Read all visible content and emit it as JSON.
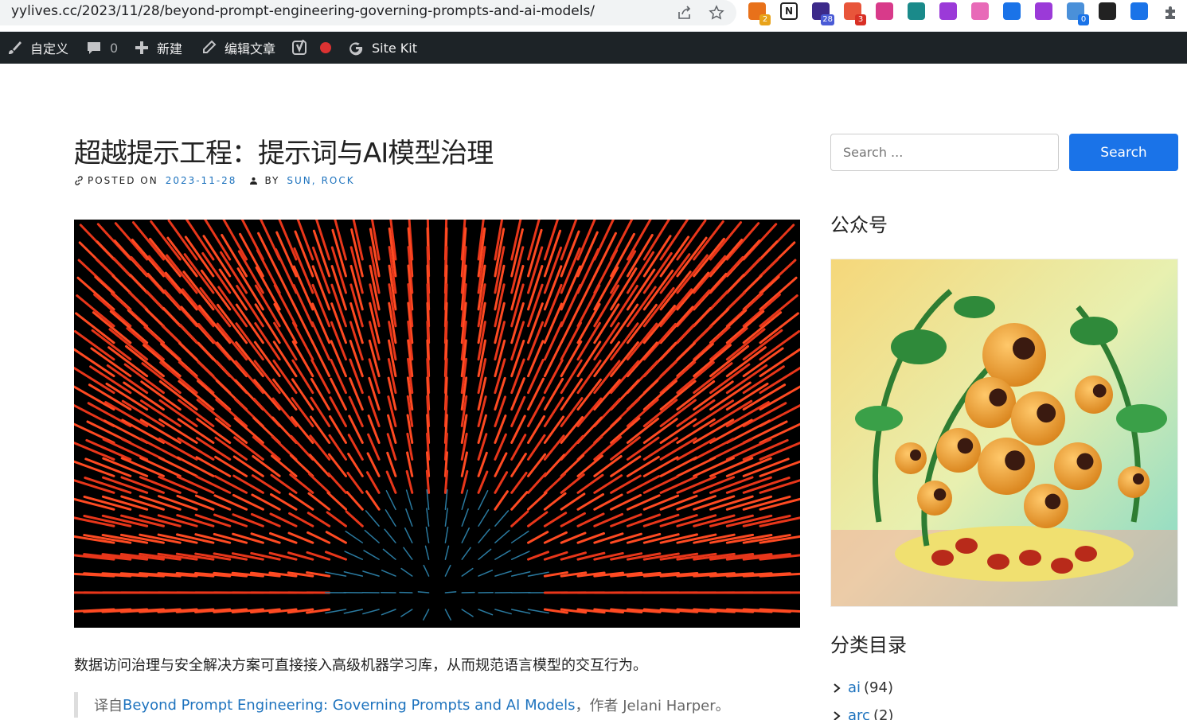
{
  "browser": {
    "url": "yylives.cc/2023/11/28/beyond-prompt-engineering-governing-prompts-and-ai-models/",
    "extensions": [
      {
        "name": "chrome-ext-1",
        "badge": "2",
        "color": "#e8711a",
        "badge_color": "#e8a31a"
      },
      {
        "name": "notion",
        "badge": "",
        "color": "#ffffff"
      },
      {
        "name": "graduation-cap",
        "badge": "28",
        "color": "#3c2a8a",
        "badge_color": "#4a5bd6"
      },
      {
        "name": "chrome-ext-4",
        "badge": "3",
        "color": "#e8553a",
        "badge_color": "#d93025"
      },
      {
        "name": "translate",
        "badge": "",
        "color": "#d83a8a"
      },
      {
        "name": "chrome-ext-6",
        "badge": "",
        "color": "#1a8a8a"
      },
      {
        "name": "chrome-ext-7",
        "badge": "",
        "color": "#9b3ad8"
      },
      {
        "name": "chrome-ext-8",
        "badge": "",
        "color": "#e86ab8"
      },
      {
        "name": "chrome-ext-9",
        "badge": "",
        "color": "#1a73e8"
      },
      {
        "name": "openai",
        "badge": "",
        "color": "#9b3ad8"
      },
      {
        "name": "chrome-ext-11",
        "badge": "0",
        "color": "#4a90d9",
        "badge_color": "#1a73e8"
      },
      {
        "name": "chrome-ext-12",
        "badge": "",
        "color": "#222222"
      },
      {
        "name": "chrome-ext-13",
        "badge": "",
        "color": "#1a73e8"
      }
    ]
  },
  "adminbar": {
    "customize": "自定义",
    "comments_count": "0",
    "new": "新建",
    "edit": "编辑文章",
    "sitekit": "Site Kit"
  },
  "post": {
    "title": "超越提示工程：提示词与AI模型治理",
    "posted_on_label": "POSTED ON",
    "date": "2023-11-28",
    "by_label": "BY",
    "author1": "SUN",
    "author_sep": ",",
    "author2": "ROCK",
    "excerpt": "数据访问治理与安全解决方案可直接接入高级机器学习库，从而规范语言模型的交互行为。",
    "quote_prefix": "译自 ",
    "quote_link": "Beyond Prompt Engineering: Governing Prompts and AI Models",
    "quote_suffix": "，作者 Jelani Harper。"
  },
  "sidebar": {
    "search_placeholder": "Search ...",
    "search_button": "Search",
    "wechat_title": "公众号",
    "categories_title": "分类目录",
    "categories": [
      {
        "name": "ai",
        "count": "(94)"
      },
      {
        "name": "arc",
        "count": "(2)"
      }
    ]
  }
}
